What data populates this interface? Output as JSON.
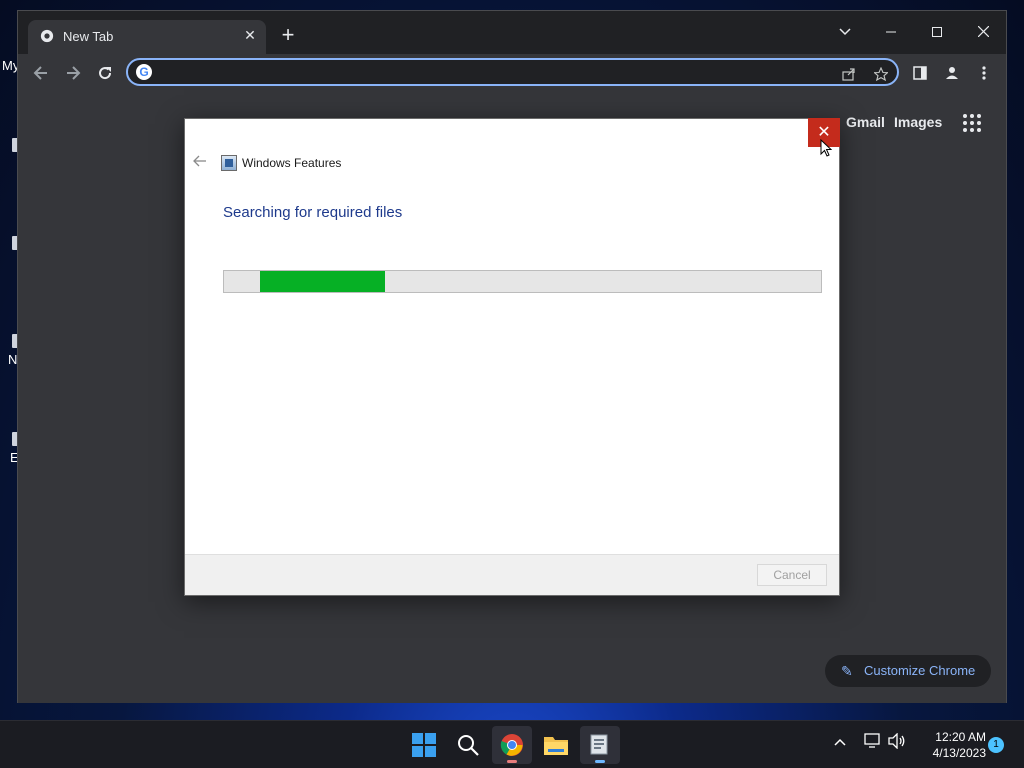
{
  "desktop": {
    "labels": [
      "My",
      "N",
      "E"
    ]
  },
  "browser": {
    "tab_title": "New Tab",
    "tab_close_glyph": "✕",
    "new_tab_glyph": "+",
    "omnibox_value": "",
    "top_links": {
      "gmail": "Gmail",
      "images": "Images"
    },
    "customize_label": "Customize Chrome"
  },
  "dialog": {
    "title": "Windows Features",
    "heading": "Searching for required files",
    "progress_start_percent": 6,
    "progress_fill_percent": 21,
    "progress_color": "#06b025",
    "cancel_label": "Cancel",
    "close_glyph": "✕",
    "close_color": "#c42b1c"
  },
  "taskbar": {
    "apps": [
      "windows-start",
      "search",
      "chrome",
      "file-explorer",
      "windows-features"
    ],
    "time": "12:20 AM",
    "date": "4/13/2023",
    "notification_count": "1"
  }
}
